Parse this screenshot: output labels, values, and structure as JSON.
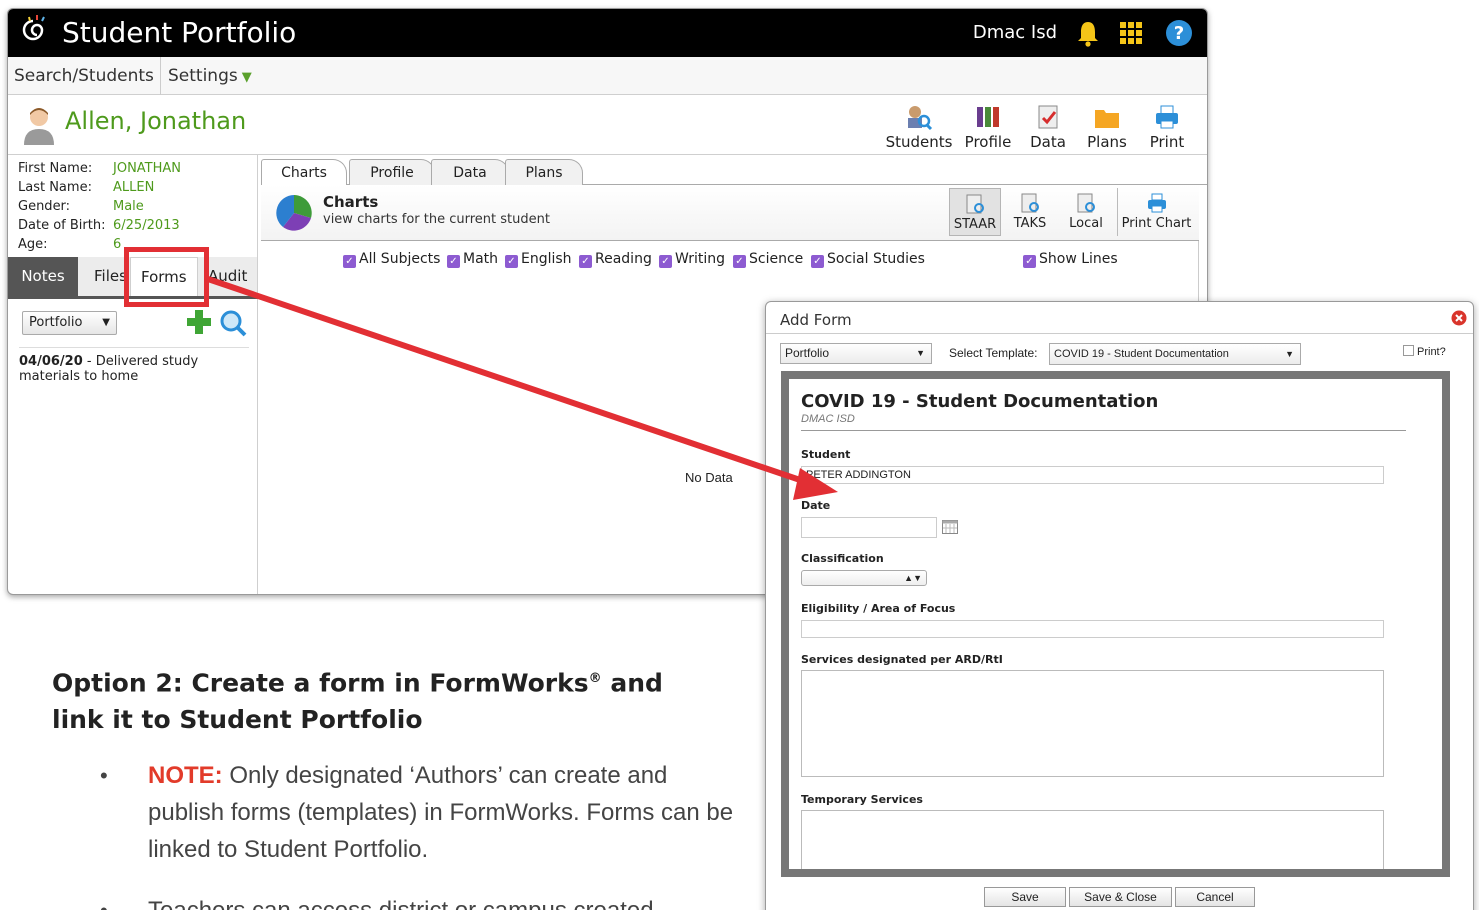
{
  "app": {
    "title": "Student Portfolio",
    "user": "Dmac Isd"
  },
  "menu": {
    "search_students": "Search/Students",
    "settings": "Settings"
  },
  "student": {
    "name": "Allen, Jonathan",
    "info": [
      {
        "label": "First Name:",
        "value": "JONATHAN"
      },
      {
        "label": "Last Name:",
        "value": "ALLEN"
      },
      {
        "label": "Gender:",
        "value": "Male"
      },
      {
        "label": "Date of Birth:",
        "value": "6/25/2013"
      },
      {
        "label": "Age:",
        "value": "6"
      }
    ]
  },
  "toolbar": {
    "students": "Students",
    "profile": "Profile",
    "data": "Data",
    "plans": "Plans",
    "print": "Print"
  },
  "left_tabs": {
    "notes": "Notes",
    "files": "Files",
    "forms": "Forms",
    "audit": "Audit"
  },
  "left_list": {
    "select_value": "Portfolio",
    "note_date": "04/06/20",
    "note_text": " - Delivered study materials to home"
  },
  "content_tabs": [
    "Charts",
    "Profile",
    "Data",
    "Plans"
  ],
  "charts": {
    "title": "Charts",
    "subtitle": "view charts for the current student",
    "tools": {
      "staar": "STAAR",
      "taks": "TAKS",
      "local": "Local",
      "print_chart": "Print Chart"
    },
    "subjects": [
      "All Subjects",
      "Math",
      "English",
      "Reading",
      "Writing",
      "Science",
      "Social Studies"
    ],
    "show_lines": "Show Lines",
    "no_data": "No Data"
  },
  "dialog": {
    "title": "Add Form",
    "portfolio": "Portfolio",
    "select_template_label": "Select Template:",
    "template_value": "COVID 19 - Student Documentation",
    "print_label": "Print?",
    "form_title": "COVID 19 - Student Documentation",
    "form_subtitle": "DMAC ISD",
    "fields": {
      "student_label": "Student",
      "student_value": "PETER ADDINGTON",
      "date_label": "Date",
      "classification_label": "Classification",
      "eligibility_label": "Eligibility / Area of Focus",
      "services_label": "Services designated per ARD/RtI",
      "temporary_label": "Temporary Services"
    },
    "buttons": {
      "save": "Save",
      "save_close": "Save & Close",
      "cancel": "Cancel"
    }
  },
  "document": {
    "heading_line1": "Option 2:  Create a form in FormWorks",
    "heading_reg": "®",
    "heading_line1_end": " and",
    "heading_line2": "link it to Student Portfolio",
    "note_label": "NOTE:",
    "note_text": " Only designated ‘Authors’ can create and publish forms (templates) in FormWorks. Forms can be linked to Student Portfolio.",
    "bullet2": "Teachers can access district or campus created"
  },
  "colors": {
    "accent_green": "#4e9a1c",
    "checkbox_purple": "#8d5bd1",
    "annotation_red": "#e22f34",
    "note_red": "#e23b2a"
  }
}
